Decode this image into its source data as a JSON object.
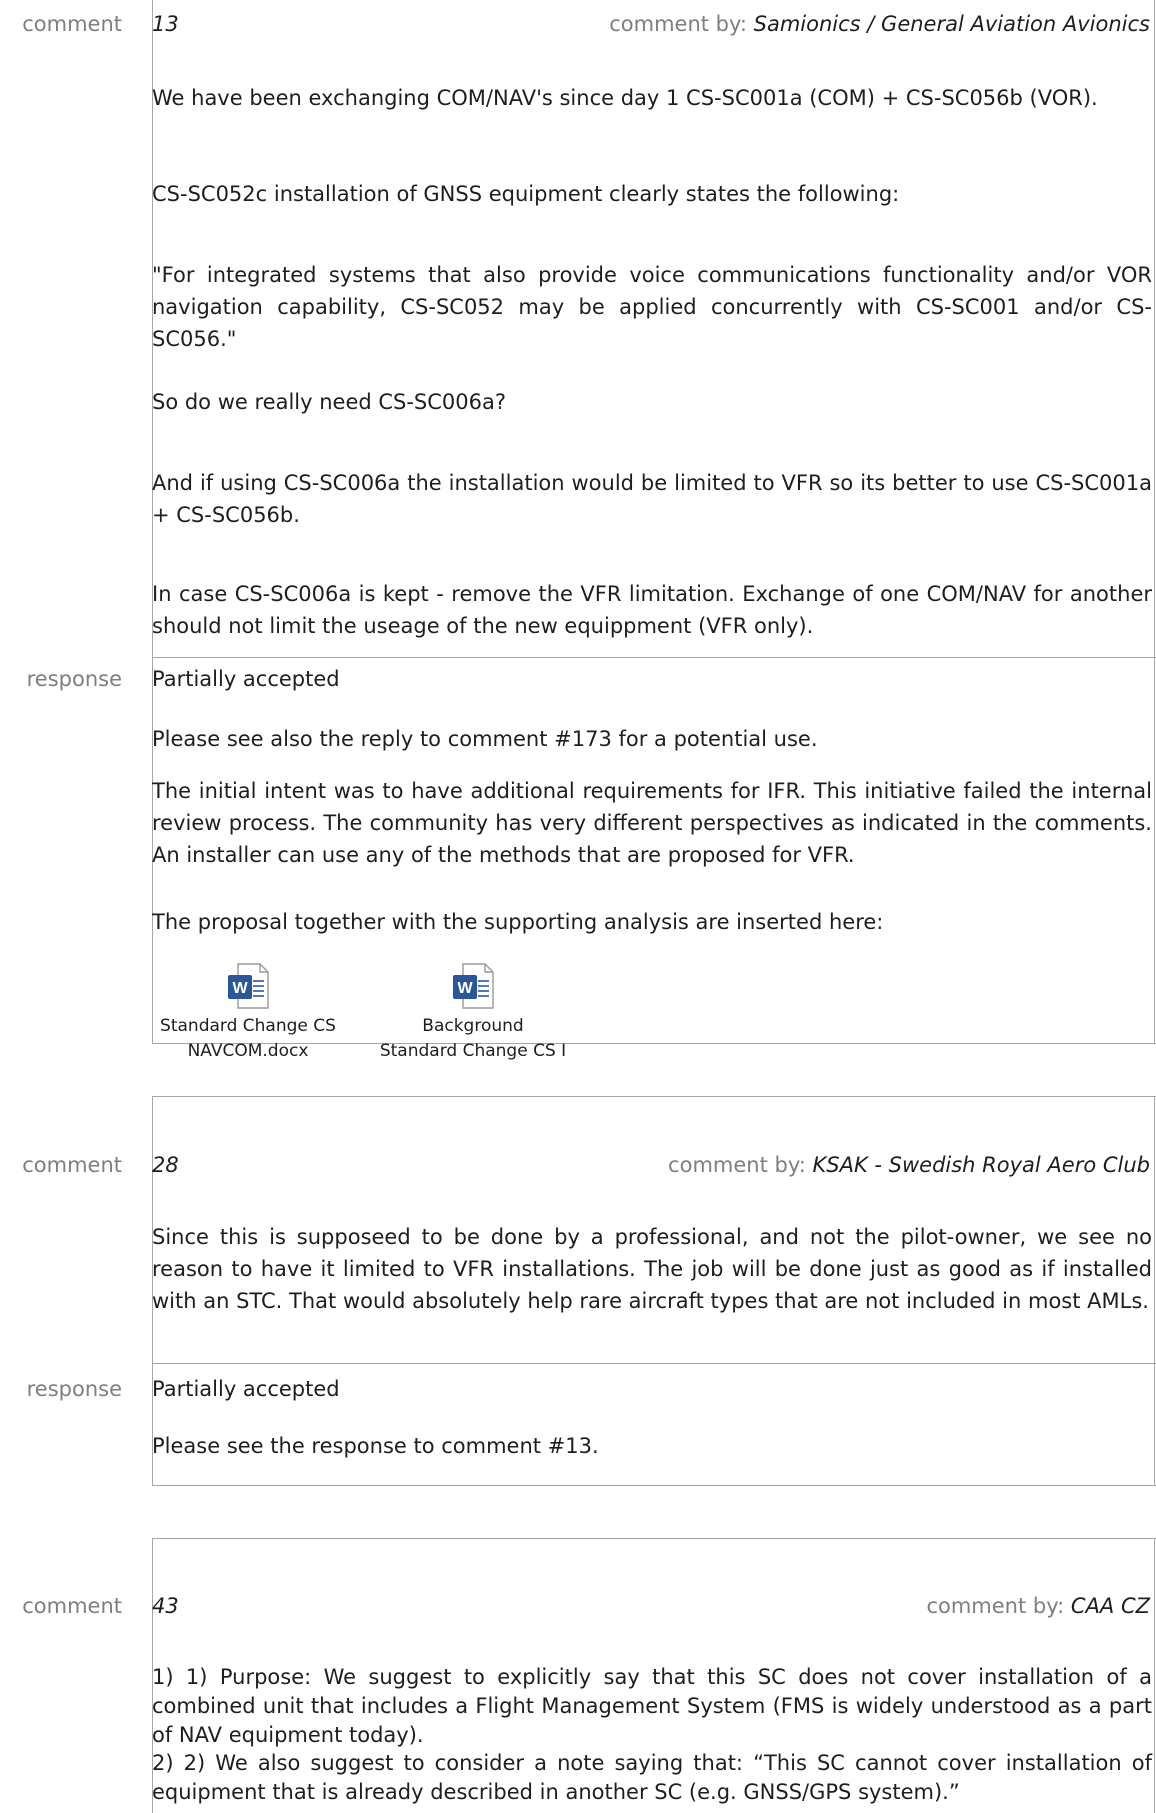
{
  "labels": {
    "comment": "comment",
    "response": "response",
    "by_prefix": "comment by: "
  },
  "c13": {
    "num": "13",
    "author": "Samionics / General Aviation Avionics",
    "p1": "We have been exchanging COM/NAV's since day 1 CS-SC001a (COM) + CS-SC056b (VOR).",
    "p2": "CS-SC052c installation of GNSS equipment clearly states the following:",
    "p3": "\"For integrated systems that also provide voice communications functionality and/or VOR navigation capability, CS-SC052 may be applied concurrently with CS-SC001 and/or CS-SC056.\"",
    "p4": "So do we really need CS-SC006a?",
    "p5": "And if using CS-SC006a the installation would be limited to VFR so its better to use CS-SC001a + CS-SC056b.",
    "p6": "In case CS-SC006a is kept - remove the VFR limitation. Exchange of one COM/NAV for another should not limit the useage of the new equippment (VFR only).",
    "r_status": "Partially accepted",
    "r1": "Please see also the reply to comment #173 for a potential use.",
    "r2": "The initial intent was to have additional requirements for IFR. This initiative failed the internal review process. The community has very different perspectives as indicated in the comments. An installer can use any of the methods that are proposed for VFR.",
    "r3": "The proposal together with the supporting analysis are inserted here:",
    "attachments": [
      {
        "line1": "Standard Change CS",
        "line2": "NAVCOM.docx",
        "icon": "word-document-icon"
      },
      {
        "line1": "Background",
        "line2": "Standard Change CS I",
        "icon": "word-document-icon"
      }
    ]
  },
  "c28": {
    "num": "28",
    "author": "KSAK - Swedish Royal Aero Club",
    "p1": "Since this is supposeed to be done by a professional, and not the pilot-owner, we see no reason to have it limited to VFR installations. The job will be done just as good as if installed with an STC. That would absolutely help rare aircraft types that are not included in most AMLs.",
    "r_status": "Partially accepted",
    "r1": "Please see the response to comment #13."
  },
  "c43": {
    "num": "43",
    "author": "CAA CZ",
    "p1": "1) 1) Purpose: We suggest to explicitly say that this SC does not cover installation of a combined unit that includes a Flight Management System (FMS is widely understood as a part of NAV equipment today).",
    "p2": "2) 2) We also suggest to consider a note saying that: “This SC cannot cover installation of equipment that is already described in another SC (e.g. GNSS/GPS system).”"
  }
}
